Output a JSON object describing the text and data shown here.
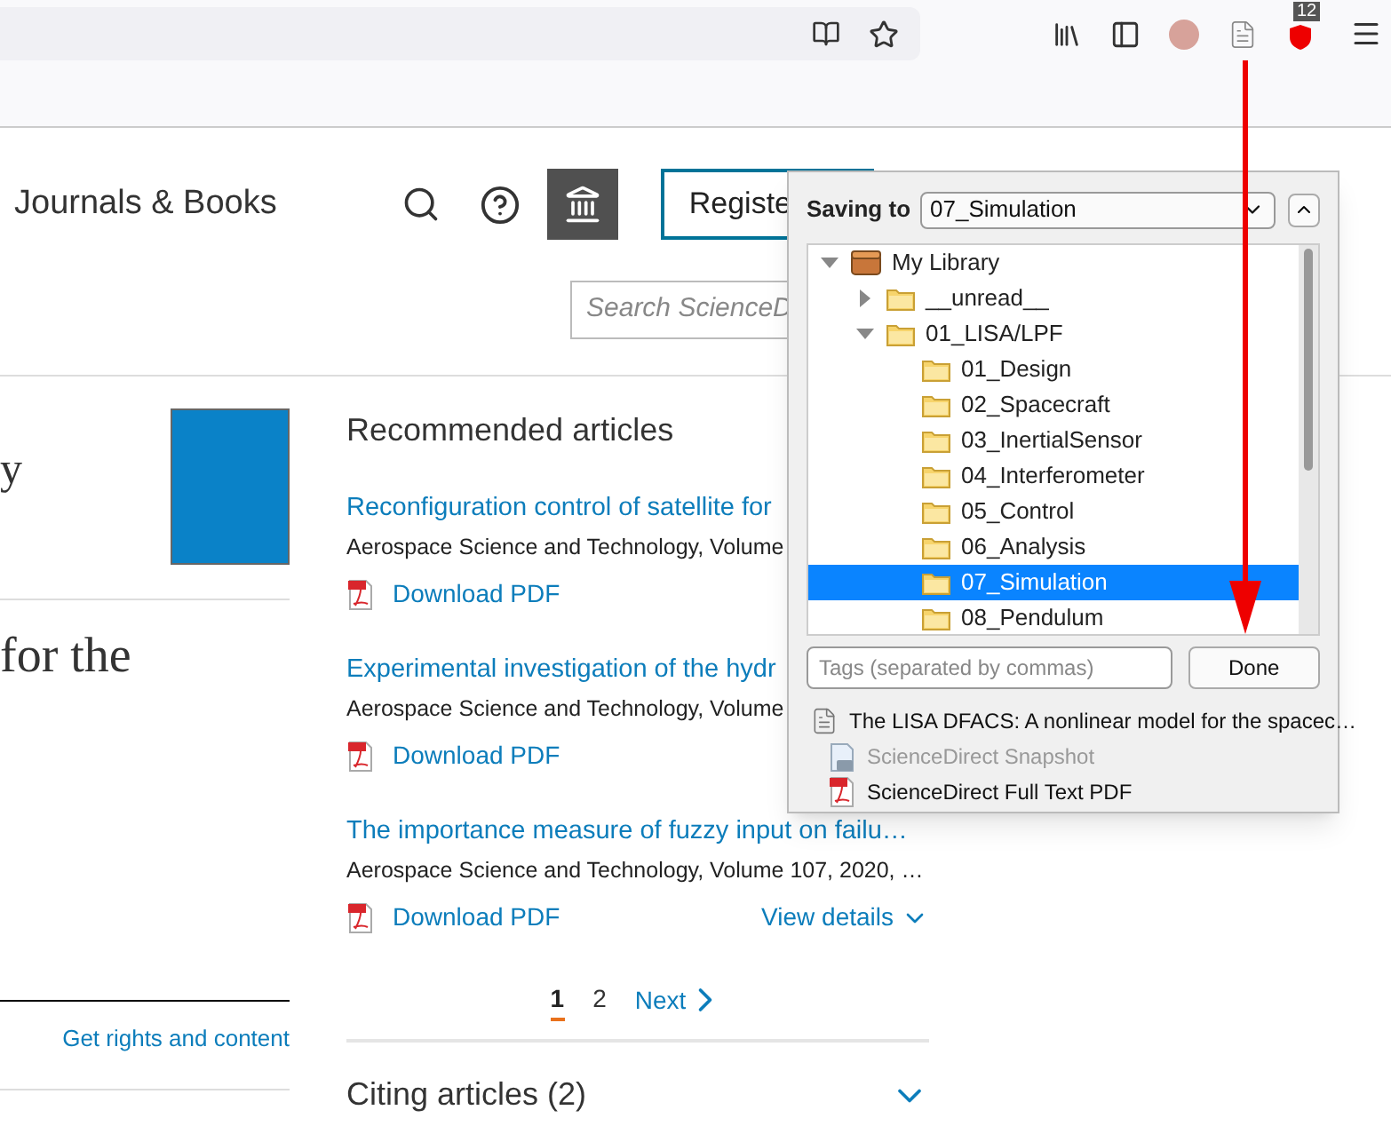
{
  "browser_toolbar": {
    "badge": "12"
  },
  "site_header": {
    "nav_link": "Journals & Books",
    "register_button": "Registe",
    "search": {
      "placeholder": "Search ScienceD"
    }
  },
  "article": {
    "title_fragments": [
      "y",
      "for the"
    ],
    "rights_link": "Get rights and content"
  },
  "recommended": {
    "heading": "Recommended articles",
    "articles": [
      {
        "title": "Reconfiguration control of satellite for",
        "source": "Aerospace Science and Technology, Volume",
        "download": "Download PDF"
      },
      {
        "title": "Experimental investigation of the hydr",
        "source": "Aerospace Science and Technology, Volume",
        "download": "Download PDF"
      },
      {
        "title": "The importance measure of fuzzy input on failu…",
        "source": "Aerospace Science and Technology, Volume 107, 2020, …",
        "download": "Download PDF",
        "details": "View details"
      }
    ],
    "pagination": {
      "pages": [
        {
          "label": "1",
          "selected": true
        },
        {
          "label": "2",
          "selected": false
        }
      ],
      "next": "Next"
    },
    "citing": "Citing articles (2)"
  },
  "zotero_popup": {
    "label": "Saving to",
    "collection": "07_Simulation",
    "tree": [
      {
        "label": "My Library",
        "kind": "library",
        "expanded": true,
        "selected": false,
        "children": [
          {
            "label": "__unread__",
            "kind": "folder",
            "expanded": false,
            "selected": false
          },
          {
            "label": "01_LISA/LPF",
            "kind": "folder",
            "expanded": true,
            "selected": false,
            "children": [
              {
                "label": "01_Design",
                "kind": "folder",
                "selected": false
              },
              {
                "label": "02_Spacecraft",
                "kind": "folder",
                "selected": false
              },
              {
                "label": "03_InertialSensor",
                "kind": "folder",
                "selected": false
              },
              {
                "label": "04_Interferometer",
                "kind": "folder",
                "selected": false
              },
              {
                "label": "05_Control",
                "kind": "folder",
                "selected": false
              },
              {
                "label": "06_Analysis",
                "kind": "folder",
                "selected": false
              },
              {
                "label": "07_Simulation",
                "kind": "folder",
                "selected": true
              },
              {
                "label": "08_Pendulum",
                "kind": "folder",
                "selected": false
              }
            ]
          }
        ]
      }
    ],
    "tags": {
      "placeholder": "Tags (separated by commas)"
    },
    "done": "Done",
    "items": [
      {
        "kind": "document",
        "label": "The LISA DFACS: A nonlinear model for the spacec…",
        "disabled": false,
        "children": [
          {
            "kind": "snapshot",
            "label": "ScienceDirect Snapshot",
            "disabled": true
          },
          {
            "kind": "pdf",
            "label": "ScienceDirect Full Text PDF",
            "disabled": false
          }
        ]
      }
    ]
  }
}
